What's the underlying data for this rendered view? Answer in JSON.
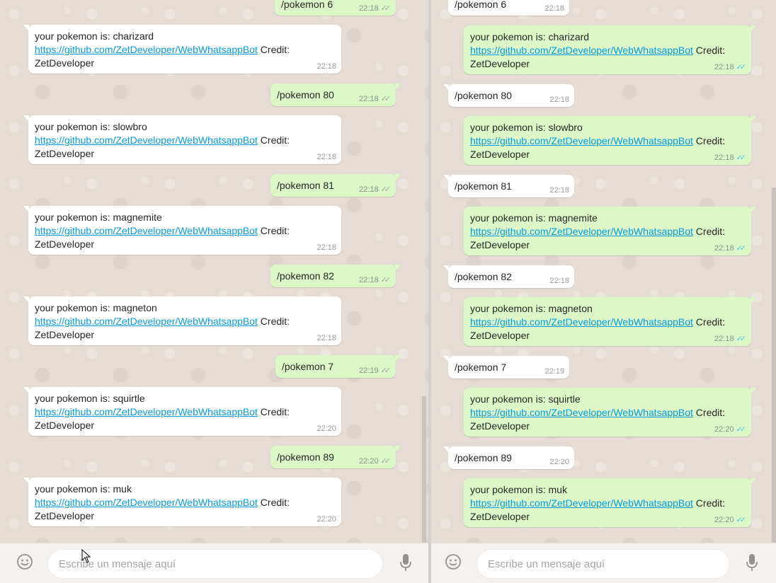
{
  "compose": {
    "placeholder": "Escribe un mensaje aquí"
  },
  "colors": {
    "chat_bg": "#e5ddd5",
    "out_bubble": "#dcf8c6",
    "in_bubble": "#ffffff",
    "link": "#039be5",
    "read_tick": "#4fc3f7"
  },
  "left_pane": {
    "messages": [
      {
        "dir": "out",
        "text": "/pokemon 6",
        "time": "22:18",
        "ticks": "grey"
      },
      {
        "dir": "in",
        "pre": "your pokemon is: charizard",
        "link": "https://github.com/ZetDeveloper/WebWhatsappBot",
        "post": " Credit:",
        "tail": "ZetDeveloper",
        "time": "22:18"
      },
      {
        "dir": "out",
        "text": "/pokemon 80",
        "time": "22:18",
        "ticks": "grey"
      },
      {
        "dir": "in",
        "pre": "your pokemon is: slowbro",
        "link": "https://github.com/ZetDeveloper/WebWhatsappBot",
        "post": " Credit:",
        "tail": "ZetDeveloper",
        "time": "22:18"
      },
      {
        "dir": "out",
        "text": "/pokemon 81",
        "time": "22:18",
        "ticks": "grey"
      },
      {
        "dir": "in",
        "pre": "your pokemon is: magnemite",
        "link": "https://github.com/ZetDeveloper/WebWhatsappBot",
        "post": " Credit:",
        "tail": "ZetDeveloper",
        "time": "22:18"
      },
      {
        "dir": "out",
        "text": "/pokemon 82",
        "time": "22:18",
        "ticks": "grey"
      },
      {
        "dir": "in",
        "pre": "your pokemon is: magneton",
        "link": "https://github.com/ZetDeveloper/WebWhatsappBot",
        "post": " Credit:",
        "tail": "ZetDeveloper",
        "time": "22:18"
      },
      {
        "dir": "out",
        "text": "/pokemon 7",
        "time": "22:19",
        "ticks": "grey"
      },
      {
        "dir": "in",
        "pre": "your pokemon is: squirtle",
        "link": "https://github.com/ZetDeveloper/WebWhatsappBot",
        "post": " Credit:",
        "tail": "ZetDeveloper",
        "time": "22:20"
      },
      {
        "dir": "out",
        "text": "/pokemon 89",
        "time": "22:20",
        "ticks": "grey"
      },
      {
        "dir": "in",
        "pre": "your pokemon is: muk",
        "link": "https://github.com/ZetDeveloper/WebWhatsappBot",
        "post": " Credit:",
        "tail": "ZetDeveloper",
        "time": "22:20"
      }
    ]
  },
  "right_pane": {
    "messages": [
      {
        "dir": "in",
        "text": "/pokemon 6",
        "time": "22:18"
      },
      {
        "dir": "out",
        "pre": "your pokemon is: charizard",
        "link": "https://github.com/ZetDeveloper/WebWhatsappBot",
        "post": " Credit:",
        "tail": "ZetDeveloper",
        "time": "22:18",
        "ticks": "blue"
      },
      {
        "dir": "in",
        "text": "/pokemon 80",
        "time": "22:18"
      },
      {
        "dir": "out",
        "pre": "your pokemon is: slowbro",
        "link": "https://github.com/ZetDeveloper/WebWhatsappBot",
        "post": " Credit:",
        "tail": "ZetDeveloper",
        "time": "22:18",
        "ticks": "blue"
      },
      {
        "dir": "in",
        "text": "/pokemon 81",
        "time": "22:18"
      },
      {
        "dir": "out",
        "pre": "your pokemon is: magnemite",
        "link": "https://github.com/ZetDeveloper/WebWhatsappBot",
        "post": " Credit:",
        "tail": "ZetDeveloper",
        "time": "22:18",
        "ticks": "blue"
      },
      {
        "dir": "in",
        "text": "/pokemon 82",
        "time": "22:18"
      },
      {
        "dir": "out",
        "pre": "your pokemon is: magneton",
        "link": "https://github.com/ZetDeveloper/WebWhatsappBot",
        "post": " Credit:",
        "tail": "ZetDeveloper",
        "time": "22:18",
        "ticks": "blue"
      },
      {
        "dir": "in",
        "text": "/pokemon 7",
        "time": "22:19"
      },
      {
        "dir": "out",
        "pre": "your pokemon is: squirtle",
        "link": "https://github.com/ZetDeveloper/WebWhatsappBot",
        "post": " Credit:",
        "tail": "ZetDeveloper",
        "time": "22:20",
        "ticks": "blue"
      },
      {
        "dir": "in",
        "text": "/pokemon 89",
        "time": "22:20"
      },
      {
        "dir": "out",
        "pre": "your pokemon is: muk",
        "link": "https://github.com/ZetDeveloper/WebWhatsappBot",
        "post": " Credit:",
        "tail": "ZetDeveloper",
        "time": "22:20",
        "ticks": "blue"
      }
    ]
  },
  "icons": {
    "emoji": "smiley-icon",
    "mic": "microphone-icon",
    "tick": "double-check-icon"
  }
}
